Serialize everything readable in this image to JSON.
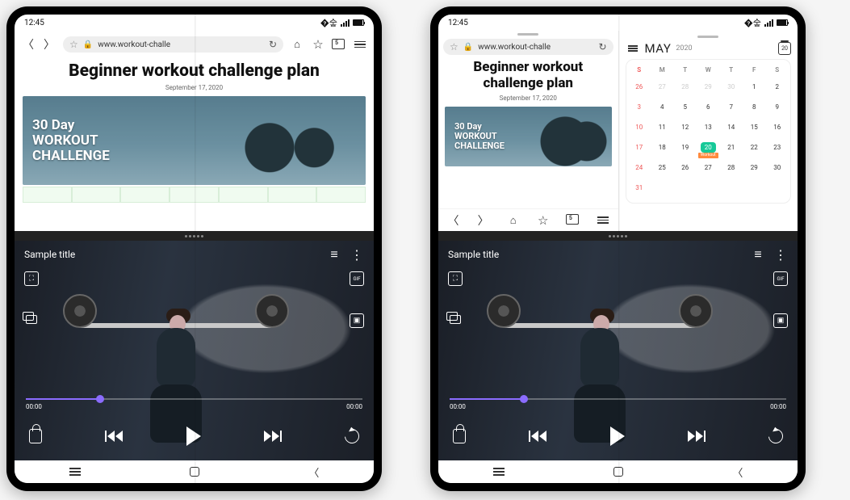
{
  "status": {
    "time": "12:45"
  },
  "browser": {
    "url_display": "www.workout-challe",
    "page_title": "Beginner workout challenge plan",
    "page_date": "September 17, 2020",
    "hero_line1": "30 Day",
    "hero_line2": "WORKOUT",
    "hero_line3": "CHALLENGE"
  },
  "calendar": {
    "month": "MAY",
    "year": "2020",
    "today_badge": "20",
    "day_headers": [
      "S",
      "M",
      "T",
      "W",
      "T",
      "F",
      "S"
    ],
    "weeks": [
      [
        "26",
        "27",
        "28",
        "29",
        "30",
        "1",
        "2"
      ],
      [
        "3",
        "4",
        "5",
        "6",
        "7",
        "8",
        "9"
      ],
      [
        "10",
        "11",
        "12",
        "13",
        "14",
        "15",
        "16"
      ],
      [
        "17",
        "18",
        "19",
        "20",
        "21",
        "22",
        "23"
      ],
      [
        "24",
        "25",
        "26",
        "27",
        "28",
        "29",
        "30"
      ],
      [
        "31",
        "",
        "",
        "",
        "",
        "",
        ""
      ]
    ],
    "event_label": "Workout"
  },
  "video": {
    "title": "Sample title",
    "elapsed": "00:00",
    "total": "00:00",
    "gif_label": "GIF"
  },
  "tabs_count": "5"
}
